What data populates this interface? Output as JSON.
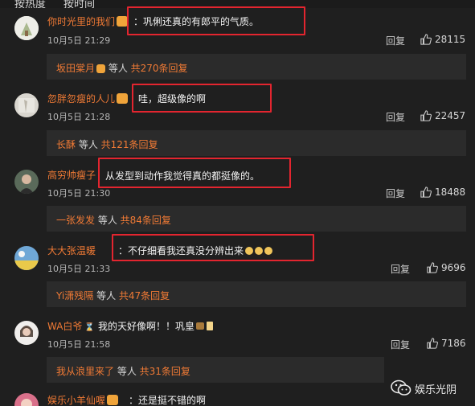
{
  "sort_tabs": [
    "按热度",
    "按时间"
  ],
  "comments": [
    {
      "user": "你时光里的我们",
      "text": "：巩俐还真的有郎平的气质。",
      "time": "10月5日 21:29",
      "reply_label": "回复",
      "likes": "28115",
      "subreplies": {
        "name": "坂田棠月",
        "mid": " 等人 ",
        "count": "共270条回复"
      }
    },
    {
      "user": "忽胖忽瘦的人儿",
      "text": "哇，超级像的啊",
      "time": "10月5日 21:28",
      "reply_label": "回复",
      "likes": "22457",
      "subreplies": {
        "name": "长酥",
        "mid": " 等人 ",
        "count": "共121条回复"
      }
    },
    {
      "user": "高穷帅瘦子",
      "text": "从发型到动作我觉得真的都挺像的。",
      "time": "10月5日 21:30",
      "reply_label": "回复",
      "likes": "18488",
      "subreplies": {
        "name": "一张发发",
        "mid": " 等人 ",
        "count": "共84条回复"
      }
    },
    {
      "user": "大大张温暖",
      "text": "：不仔细看我还真没分辨出来",
      "time": "10月5日 21:33",
      "reply_label": "回复",
      "likes": "9696",
      "subreplies": {
        "name": "Yi潇残隔",
        "mid": " 等人 ",
        "count": "共47条回复"
      }
    },
    {
      "user": "WA白爷",
      "text": "：我的天好像啊！！巩皇",
      "time": "10月5日 21:58",
      "reply_label": "回复",
      "likes": "7186",
      "subreplies": {
        "name": "我从浪里来了",
        "mid": " 等人 ",
        "count": "共31条回复"
      }
    },
    {
      "user": "娱乐小羊仙喔",
      "text": "：还是挺不错的啊"
    }
  ],
  "watermark": {
    "text": "娱乐光阴",
    "icon": "wechat-icon"
  },
  "colors": {
    "username": "#f07a35",
    "highlight_box": "#e3252f",
    "background": "#1f1f1f"
  }
}
